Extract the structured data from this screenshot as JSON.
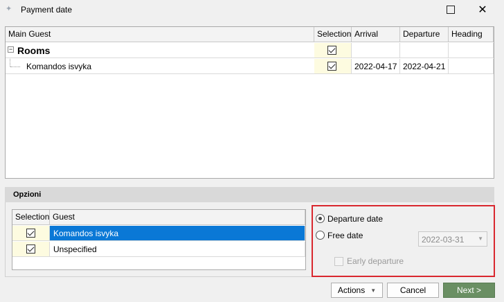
{
  "window": {
    "title": "Payment date"
  },
  "grid": {
    "headers": {
      "main_guest": "Main Guest",
      "selection": "Selection",
      "arrival": "Arrival",
      "departure": "Departure",
      "heading": "Heading"
    },
    "group_row": {
      "toggle": "−",
      "label": "Rooms"
    },
    "rows": [
      {
        "main_guest": "Komandos isvyka",
        "selected": true,
        "arrival": "2022-04-17",
        "departure": "2022-04-21",
        "heading": ""
      }
    ]
  },
  "options": {
    "title": "Opzioni",
    "guest_grid": {
      "headers": {
        "selection": "Selection",
        "guest": "Guest"
      },
      "rows": [
        {
          "selected": true,
          "guest": "Komandos isvyka",
          "highlighted": true
        },
        {
          "selected": true,
          "guest": "Unspecified",
          "highlighted": false
        }
      ]
    },
    "departure_date_label": "Departure date",
    "free_date_label": "Free date",
    "free_date_value": "2022-03-31",
    "early_departure_label": "Early departure",
    "selected_radio": "departure_date"
  },
  "buttons": {
    "actions": "Actions",
    "cancel": "Cancel",
    "next": "Next >"
  },
  "colors": {
    "highlight": "#0a78d6",
    "next_button": "#6a8f63",
    "callout": "#d9272e"
  }
}
